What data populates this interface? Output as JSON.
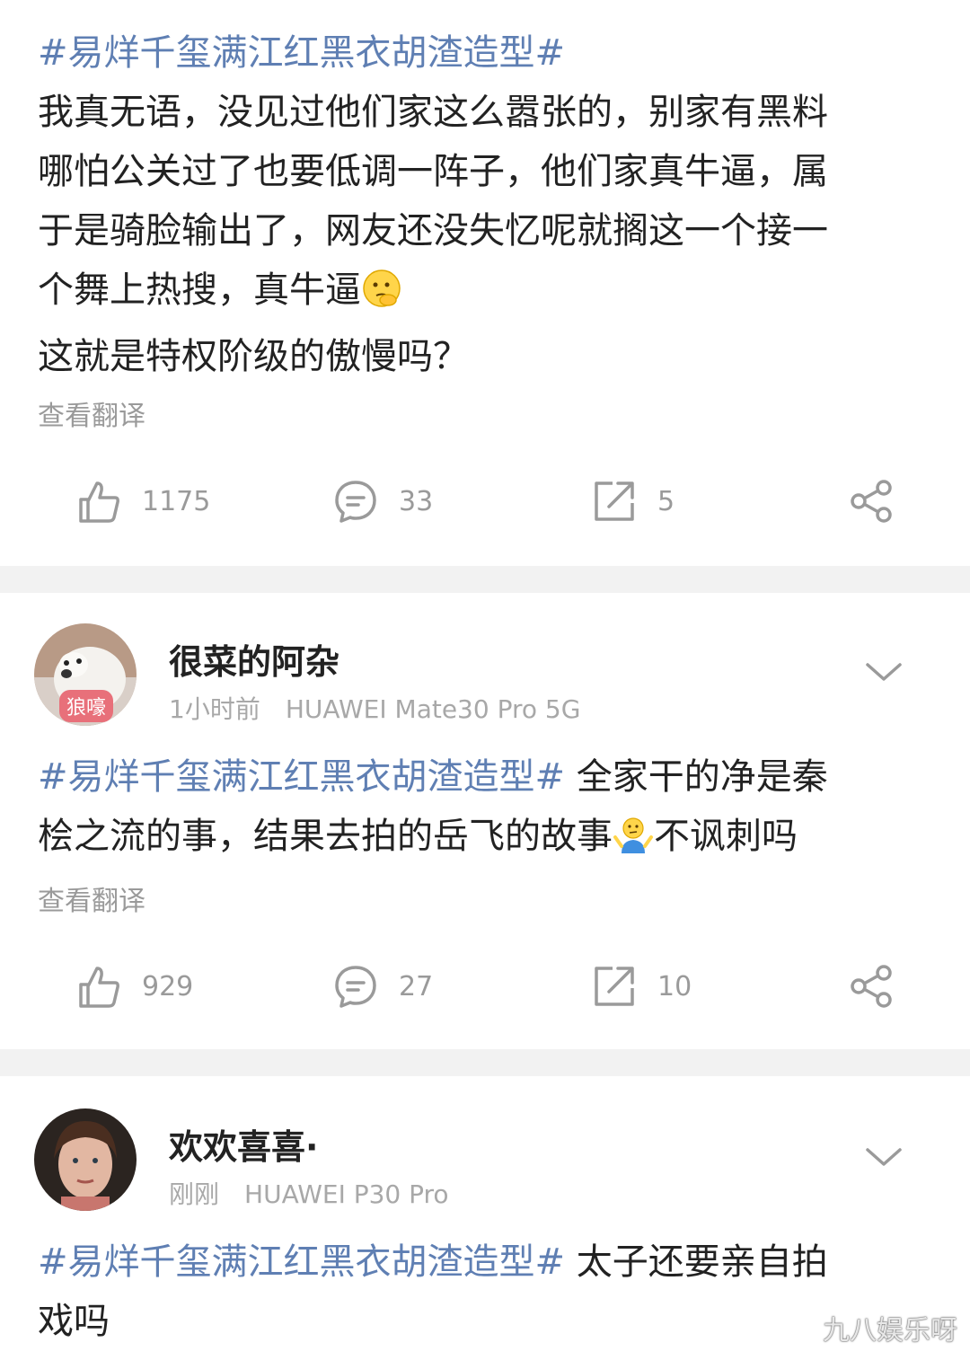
{
  "posts": [
    {
      "tag": "#易烊千玺满江红黑衣胡渣造型#",
      "body_lines": [
        "我真无语，没见过他们家这么嚣张的，别家有黑料",
        "哪怕公关过了也要低调一阵子，他们家真牛逼，属",
        "于是骑脸输出了，网友还没失忆呢就搁这一个接一",
        "个舞上热搜，真牛逼"
      ],
      "body_last": "这就是特权阶级的傲慢吗？",
      "translate": "查看翻译",
      "likes": "1175",
      "comments": "33",
      "reposts": "5"
    },
    {
      "user": "很菜的阿杂",
      "badge": "狼嚎",
      "time": "1小时前",
      "device": "HUAWEI Mate30 Pro 5G",
      "tag": "#易烊千玺满江红黑衣胡渣造型#",
      "text_a": " 全家干的净是秦",
      "text_b": "桧之流的事，结果去拍的岳飞的故事",
      "text_c": "不讽刺吗",
      "translate": "查看翻译",
      "likes": "929",
      "comments": "27",
      "reposts": "10"
    },
    {
      "user": "欢欢喜喜·",
      "time": "刚刚",
      "device": "HUAWEI P30 Pro",
      "tag": "#易烊千玺满江红黑衣胡渣造型#",
      "text_a": " 太子还要亲自拍",
      "text_b": "戏吗"
    }
  ],
  "watermark": "九八娱乐呀",
  "icons": {
    "like": "thumbs-up-icon",
    "comment": "comment-bubble-icon",
    "repost": "repost-icon",
    "share": "share-icon",
    "more": "chevron-down-icon"
  },
  "colors": {
    "tag": "#5f7fb3",
    "muted": "#9a9a9a",
    "separator": "#f2f2f2"
  }
}
